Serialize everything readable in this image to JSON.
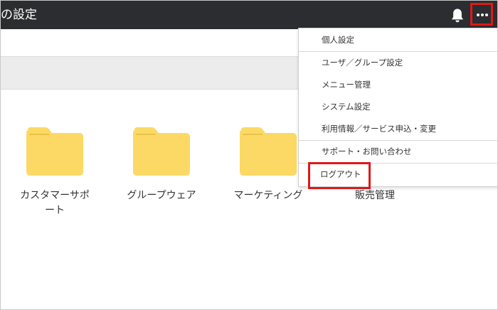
{
  "header": {
    "title": "の設定",
    "bell_icon": "bell-icon",
    "more_icon": "ellipsis-icon"
  },
  "folders": [
    {
      "label": "カスタマーサポ\nート",
      "icon": "folder-icon"
    },
    {
      "label": "グループウェア",
      "icon": "folder-icon"
    },
    {
      "label": "マーケティング",
      "icon": "folder-icon"
    },
    {
      "label": "販売管理",
      "icon": "folder-icon"
    }
  ],
  "menu": {
    "items": [
      {
        "label": "個人設定"
      },
      {
        "label": "ユーザ／グループ設定"
      },
      {
        "label": "メニュー管理"
      },
      {
        "label": "システム設定"
      },
      {
        "label": "利用情報／サービス申込・変更"
      },
      {
        "label": "サポート・お問い合わせ"
      },
      {
        "label": "ログアウト"
      }
    ]
  },
  "colors": {
    "header_bg": "#2b2d30",
    "folder": "#fcd964",
    "highlight": "#e01818"
  }
}
